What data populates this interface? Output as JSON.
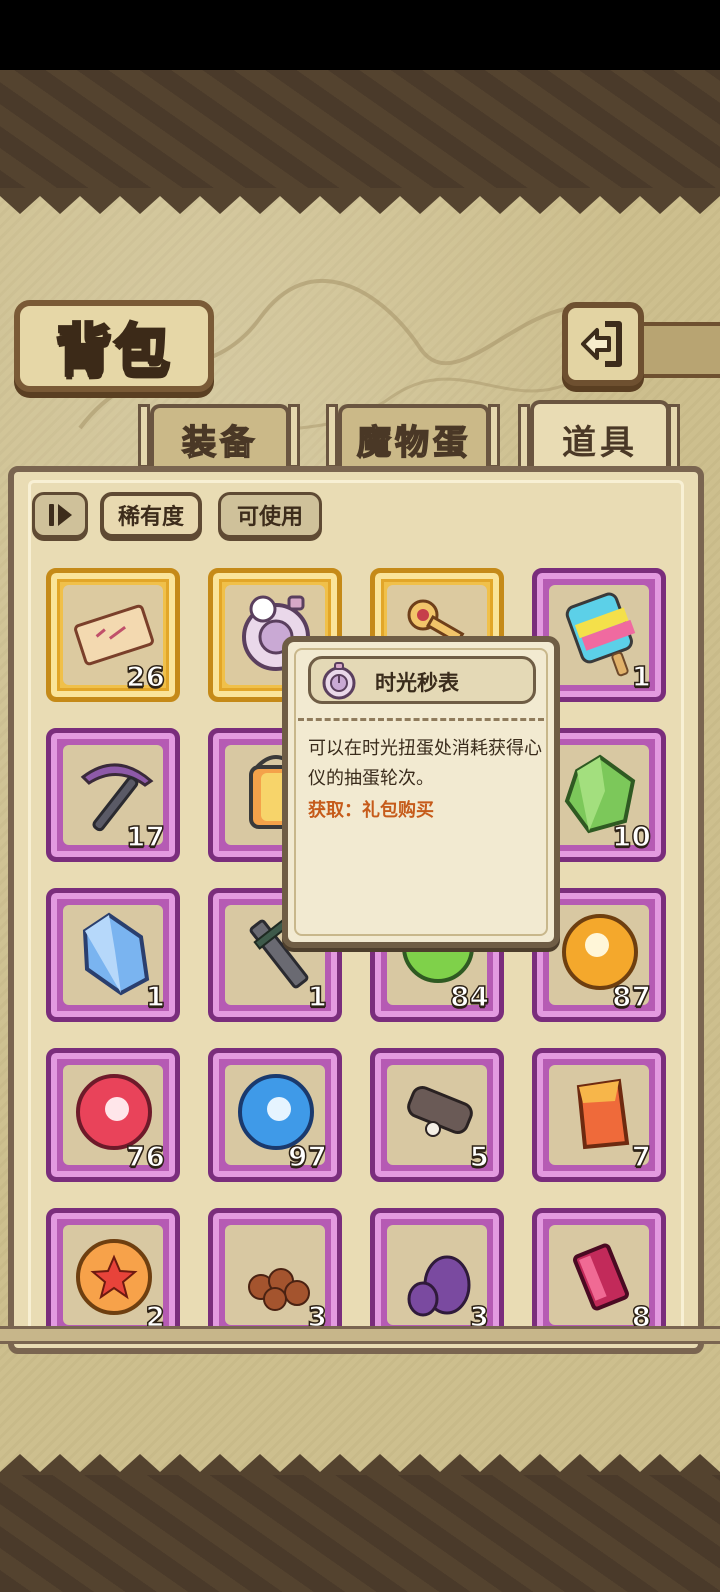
{
  "header": {
    "title": "背包",
    "back_icon": "back-arrow-icon"
  },
  "tabs": [
    {
      "label": "装备",
      "active": false
    },
    {
      "label": "魔物蛋",
      "active": false
    },
    {
      "label": "道具",
      "active": true
    }
  ],
  "filters": {
    "sort_icon": "sort-toggle-icon",
    "rarity": "稀有度",
    "usable": "可使用"
  },
  "items": [
    {
      "name": "ticket",
      "count": "26",
      "rarity": "gold",
      "icon": "ticket-icon"
    },
    {
      "name": "time-stopwatch",
      "count": "",
      "rarity": "gold",
      "icon": "stopwatch-icon"
    },
    {
      "name": "golden-key",
      "count": "",
      "rarity": "gold",
      "icon": "key-icon"
    },
    {
      "name": "rainbow-popsicle",
      "count": "1",
      "rarity": "purple",
      "icon": "popsicle-icon"
    },
    {
      "name": "pickaxe",
      "count": "17",
      "rarity": "purple",
      "icon": "pickaxe-icon"
    },
    {
      "name": "lantern-canister",
      "count": "",
      "rarity": "purple",
      "icon": "lantern-icon"
    },
    {
      "name": "hidden-item",
      "count": "",
      "rarity": "purple",
      "icon": "hidden-icon"
    },
    {
      "name": "green-crystal",
      "count": "10",
      "rarity": "purple",
      "icon": "green-crystal-icon"
    },
    {
      "name": "blue-crystal",
      "count": "1",
      "rarity": "purple",
      "icon": "blue-crystal-icon"
    },
    {
      "name": "dark-sword",
      "count": "1",
      "rarity": "purple",
      "icon": "sword-icon"
    },
    {
      "name": "green-orb",
      "count": "84",
      "rarity": "purple",
      "icon": "green-orb-icon"
    },
    {
      "name": "orange-orb",
      "count": "87",
      "rarity": "purple",
      "icon": "orange-orb-icon"
    },
    {
      "name": "red-orb",
      "count": "76",
      "rarity": "purple",
      "icon": "red-orb-icon"
    },
    {
      "name": "blue-orb",
      "count": "97",
      "rarity": "purple",
      "icon": "blue-orb-icon"
    },
    {
      "name": "skull-bullet",
      "count": "5",
      "rarity": "purple",
      "icon": "bullet-icon"
    },
    {
      "name": "red-ore",
      "count": "7",
      "rarity": "purple",
      "icon": "red-ore-icon"
    },
    {
      "name": "star-orb",
      "count": "2",
      "rarity": "purple",
      "icon": "star-orb-icon"
    },
    {
      "name": "brown-beans",
      "count": "3",
      "rarity": "purple",
      "icon": "beans-icon"
    },
    {
      "name": "purple-eggs",
      "count": "3",
      "rarity": "purple",
      "icon": "eggs-icon"
    },
    {
      "name": "magenta-gem",
      "count": "8",
      "rarity": "purple",
      "icon": "gem-icon"
    }
  ],
  "tooltip": {
    "title": "时光秒表",
    "description": "可以在时光扭蛋处消耗获得心仪的抽蛋轮次。",
    "source": "获取：礼包购买",
    "icon": "stopwatch-icon"
  },
  "colors": {
    "gold_frame": "#f0c04a",
    "purple_frame": "#b55bb4",
    "parchment": "#cdbf8e",
    "source_text": "#c65b1a"
  }
}
